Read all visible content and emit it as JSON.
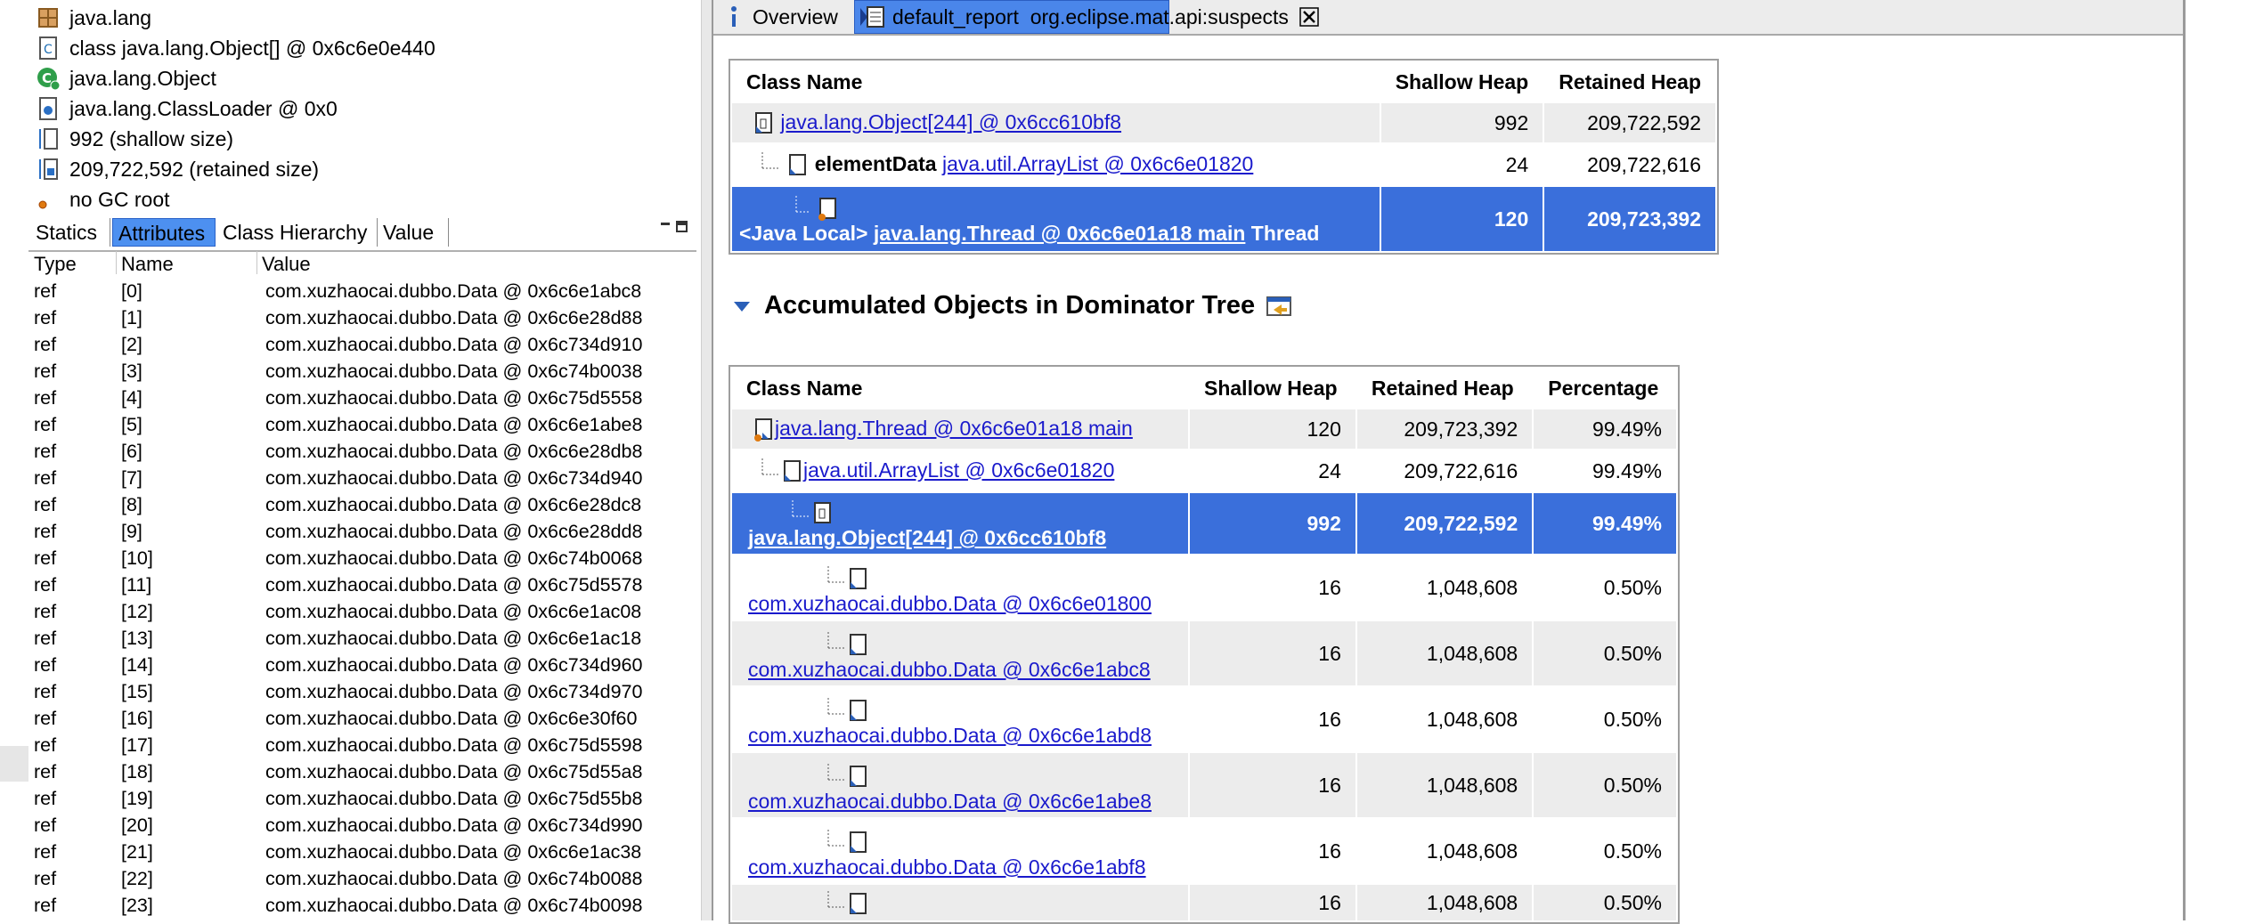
{
  "inspector": {
    "info": [
      {
        "icon": "package-icon",
        "text": "java.lang"
      },
      {
        "icon": "class-file-icon",
        "text": "class java.lang.Object[] @ 0x6c6e0e440"
      },
      {
        "icon": "class-c-icon",
        "text": "java.lang.Object"
      },
      {
        "icon": "classloader-icon",
        "text": "java.lang.ClassLoader @ 0x0"
      },
      {
        "icon": "shallow-size-icon",
        "text": "992 (shallow size)"
      },
      {
        "icon": "retained-size-icon",
        "text": "209,722,592 (retained size)"
      },
      {
        "icon": "gc-root-icon",
        "text": "no GC root"
      }
    ],
    "tabs": [
      "Statics",
      "Attributes",
      "Class Hierarchy",
      "Value"
    ],
    "active_tab": "Attributes",
    "columns": [
      "Type",
      "Name",
      "Value"
    ],
    "rows": [
      {
        "type": "ref",
        "name": "[0]",
        "value": "com.xuzhaocai.dubbo.Data @ 0x6c6e1abc8"
      },
      {
        "type": "ref",
        "name": "[1]",
        "value": "com.xuzhaocai.dubbo.Data @ 0x6c6e28d88"
      },
      {
        "type": "ref",
        "name": "[2]",
        "value": "com.xuzhaocai.dubbo.Data @ 0x6c734d910"
      },
      {
        "type": "ref",
        "name": "[3]",
        "value": "com.xuzhaocai.dubbo.Data @ 0x6c74b0038"
      },
      {
        "type": "ref",
        "name": "[4]",
        "value": "com.xuzhaocai.dubbo.Data @ 0x6c75d5558"
      },
      {
        "type": "ref",
        "name": "[5]",
        "value": "com.xuzhaocai.dubbo.Data @ 0x6c6e1abe8"
      },
      {
        "type": "ref",
        "name": "[6]",
        "value": "com.xuzhaocai.dubbo.Data @ 0x6c6e28db8"
      },
      {
        "type": "ref",
        "name": "[7]",
        "value": "com.xuzhaocai.dubbo.Data @ 0x6c734d940"
      },
      {
        "type": "ref",
        "name": "[8]",
        "value": "com.xuzhaocai.dubbo.Data @ 0x6c6e28dc8"
      },
      {
        "type": "ref",
        "name": "[9]",
        "value": "com.xuzhaocai.dubbo.Data @ 0x6c6e28dd8"
      },
      {
        "type": "ref",
        "name": "[10]",
        "value": "com.xuzhaocai.dubbo.Data @ 0x6c74b0068"
      },
      {
        "type": "ref",
        "name": "[11]",
        "value": "com.xuzhaocai.dubbo.Data @ 0x6c75d5578"
      },
      {
        "type": "ref",
        "name": "[12]",
        "value": "com.xuzhaocai.dubbo.Data @ 0x6c6e1ac08"
      },
      {
        "type": "ref",
        "name": "[13]",
        "value": "com.xuzhaocai.dubbo.Data @ 0x6c6e1ac18"
      },
      {
        "type": "ref",
        "name": "[14]",
        "value": "com.xuzhaocai.dubbo.Data @ 0x6c734d960"
      },
      {
        "type": "ref",
        "name": "[15]",
        "value": "com.xuzhaocai.dubbo.Data @ 0x6c734d970"
      },
      {
        "type": "ref",
        "name": "[16]",
        "value": "com.xuzhaocai.dubbo.Data @ 0x6c6e30f60"
      },
      {
        "type": "ref",
        "name": "[17]",
        "value": "com.xuzhaocai.dubbo.Data @ 0x6c75d5598"
      },
      {
        "type": "ref",
        "name": "[18]",
        "value": "com.xuzhaocai.dubbo.Data @ 0x6c75d55a8"
      },
      {
        "type": "ref",
        "name": "[19]",
        "value": "com.xuzhaocai.dubbo.Data @ 0x6c75d55b8"
      },
      {
        "type": "ref",
        "name": "[20]",
        "value": "com.xuzhaocai.dubbo.Data @ 0x6c734d990"
      },
      {
        "type": "ref",
        "name": "[21]",
        "value": "com.xuzhaocai.dubbo.Data @ 0x6c6e1ac38"
      },
      {
        "type": "ref",
        "name": "[22]",
        "value": "com.xuzhaocai.dubbo.Data @ 0x6c74b0088"
      },
      {
        "type": "ref",
        "name": "[23]",
        "value": "com.xuzhaocai.dubbo.Data @ 0x6c74b0098"
      }
    ]
  },
  "editor": {
    "tab_overview": "Overview",
    "tab_report": "default_report  org.eclipse.mat.api:suspects"
  },
  "path_table": {
    "columns": [
      "Class Name",
      "Shallow Heap",
      "Retained Heap"
    ],
    "rows": [
      {
        "prefix": "",
        "link": "java.lang.Object[244] @ 0x6cc610bf8",
        "suffix": "",
        "shallow": "992",
        "retained": "209,722,592"
      },
      {
        "prefix": "elementData",
        "link": "java.util.ArrayList @ 0x6c6e01820",
        "suffix": "",
        "shallow": "24",
        "retained": "209,722,616"
      },
      {
        "prefix": "<Java Local>",
        "link": "java.lang.Thread @ 0x6c6e01a18 main",
        "suffix": "Thread",
        "shallow": "120",
        "retained": "209,723,392"
      }
    ]
  },
  "accumulated": {
    "title": "Accumulated Objects in Dominator Tree",
    "columns": [
      "Class Name",
      "Shallow Heap",
      "Retained Heap",
      "Percentage"
    ],
    "rows": [
      {
        "link": "java.lang.Thread @ 0x6c6e01a18 main",
        "shallow": "120",
        "retained": "209,723,392",
        "pct": "99.49%"
      },
      {
        "link": "java.util.ArrayList @ 0x6c6e01820",
        "shallow": "24",
        "retained": "209,722,616",
        "pct": "99.49%"
      },
      {
        "link": "java.lang.Object[244] @ 0x6cc610bf8",
        "shallow": "992",
        "retained": "209,722,592",
        "pct": "99.49%"
      },
      {
        "link": "com.xuzhaocai.dubbo.Data @ 0x6c6e01800",
        "shallow": "16",
        "retained": "1,048,608",
        "pct": "0.50%"
      },
      {
        "link": "com.xuzhaocai.dubbo.Data @ 0x6c6e1abc8",
        "shallow": "16",
        "retained": "1,048,608",
        "pct": "0.50%"
      },
      {
        "link": "com.xuzhaocai.dubbo.Data @ 0x6c6e1abd8",
        "shallow": "16",
        "retained": "1,048,608",
        "pct": "0.50%"
      },
      {
        "link": "com.xuzhaocai.dubbo.Data @ 0x6c6e1abe8",
        "shallow": "16",
        "retained": "1,048,608",
        "pct": "0.50%"
      },
      {
        "link": "com.xuzhaocai.dubbo.Data @ 0x6c6e1abf8",
        "shallow": "16",
        "retained": "1,048,608",
        "pct": "0.50%"
      },
      {
        "link": "",
        "shallow": "16",
        "retained": "1,048,608",
        "pct": "0.50%"
      }
    ]
  },
  "colors": {
    "selection": "#3a6fdb",
    "tab_active": "#4a86ea",
    "link": "#1a1acc",
    "row_alt": "#ececec"
  }
}
